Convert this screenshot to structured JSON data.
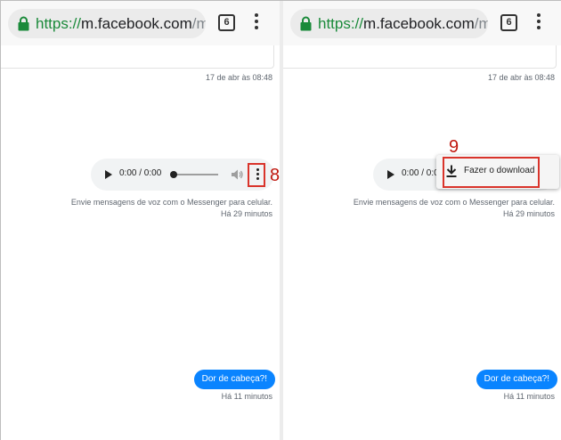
{
  "browser": {
    "url_scheme": "https://",
    "url_host": "m.facebook.com",
    "url_path": "/mes",
    "tab_count": "6",
    "icons": {
      "lock": "lock-icon",
      "menu": "more-vert-icon"
    },
    "colors": {
      "secure_green": "#1a8a3a"
    }
  },
  "conversation": {
    "date_separator": "17 de abr às 08:48",
    "audio_time": "0:00 / 0:00",
    "voice_caption": "Envie mensagens de voz com o Messenger para celular.",
    "voice_time_ago": "Há 29 minutos",
    "message_text": "Dor de cabeça?!",
    "message_time_ago": "Há 11 minutos",
    "bubble_color": "#0a84ff"
  },
  "annotations": {
    "step_left": "8",
    "step_right": "9",
    "highlight_color": "#d9342b"
  },
  "download_menu": {
    "item_label": "Fazer o download",
    "icon": "download-icon"
  }
}
